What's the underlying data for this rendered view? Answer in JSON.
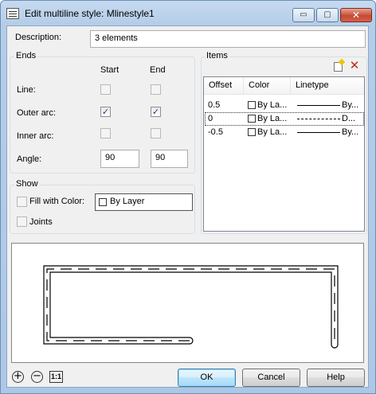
{
  "window": {
    "title": "Edit multiline style: Mlinestyle1",
    "buttons": {
      "minimize": "▭",
      "maximize": "▢",
      "close": "✕"
    }
  },
  "description": {
    "label": "Description:",
    "value": "3 elements"
  },
  "ends": {
    "group_label": "Ends",
    "col_start": "Start",
    "col_end": "End",
    "rows": [
      {
        "label": "Line:",
        "start_checked": false,
        "end_checked": false
      },
      {
        "label": "Outer arc:",
        "start_checked": true,
        "end_checked": true
      },
      {
        "label": "Inner arc:",
        "start_checked": false,
        "end_checked": false
      }
    ],
    "angle_label": "Angle:",
    "angle_start": "90",
    "angle_end": "90"
  },
  "show": {
    "group_label": "Show",
    "fill_label": "Fill with Color:",
    "fill_checked": false,
    "fill_value": "By Layer",
    "joints_label": "Joints",
    "joints_checked": false
  },
  "items": {
    "group_label": "Items",
    "toolbar": {
      "add_icon": "new-item-icon",
      "delete_icon": "delete-x-icon"
    },
    "headers": [
      "Offset",
      "Color",
      "Linetype"
    ],
    "rows": [
      {
        "offset": "0.5",
        "color": "By La...",
        "linetype": "By...",
        "line_style": "solid"
      },
      {
        "offset": "0",
        "color": "By La...",
        "linetype": "D...",
        "line_style": "dashed"
      },
      {
        "offset": "-0.5",
        "color": "By La...",
        "linetype": "By...",
        "line_style": "solid"
      }
    ],
    "selected_index": 1
  },
  "footer": {
    "zoom_in": "+",
    "zoom_out": "−",
    "one_to_one": "1:1",
    "ok": "OK",
    "cancel": "Cancel",
    "help": "Help"
  },
  "colors": {
    "check": "#1a3e8a",
    "close_button": "#c44a33",
    "delete_icon": "#c0281c"
  }
}
